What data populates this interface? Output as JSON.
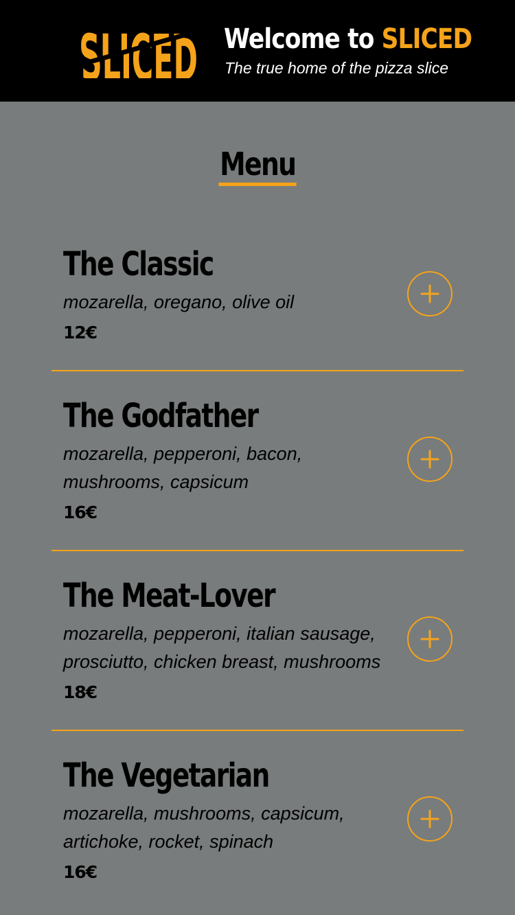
{
  "header": {
    "logo_text": "SLICED",
    "welcome_prefix": "Welcome to ",
    "welcome_brand": "SLICED",
    "tagline": "The true home of the pizza slice"
  },
  "menu": {
    "title": "Menu",
    "items": [
      {
        "name": "The Classic",
        "description": "mozarella, oregano, olive oil",
        "price": "12€"
      },
      {
        "name": "The Godfather",
        "description": "mozarella, pepperoni, bacon, mushrooms, capsicum",
        "price": "16€"
      },
      {
        "name": "The Meat-Lover",
        "description": "mozarella, pepperoni, italian sausage, prosciutto, chicken breast, mushrooms",
        "price": "18€"
      },
      {
        "name": "The Vegetarian",
        "description": "mozarella, mushrooms, capsicum, artichoke, rocket, spinach",
        "price": "16€"
      }
    ],
    "add_icon": "plus-icon"
  },
  "colors": {
    "accent": "#f5a31a",
    "header_background": "#000000",
    "page_background": "#787c7c",
    "text": "#000000"
  }
}
